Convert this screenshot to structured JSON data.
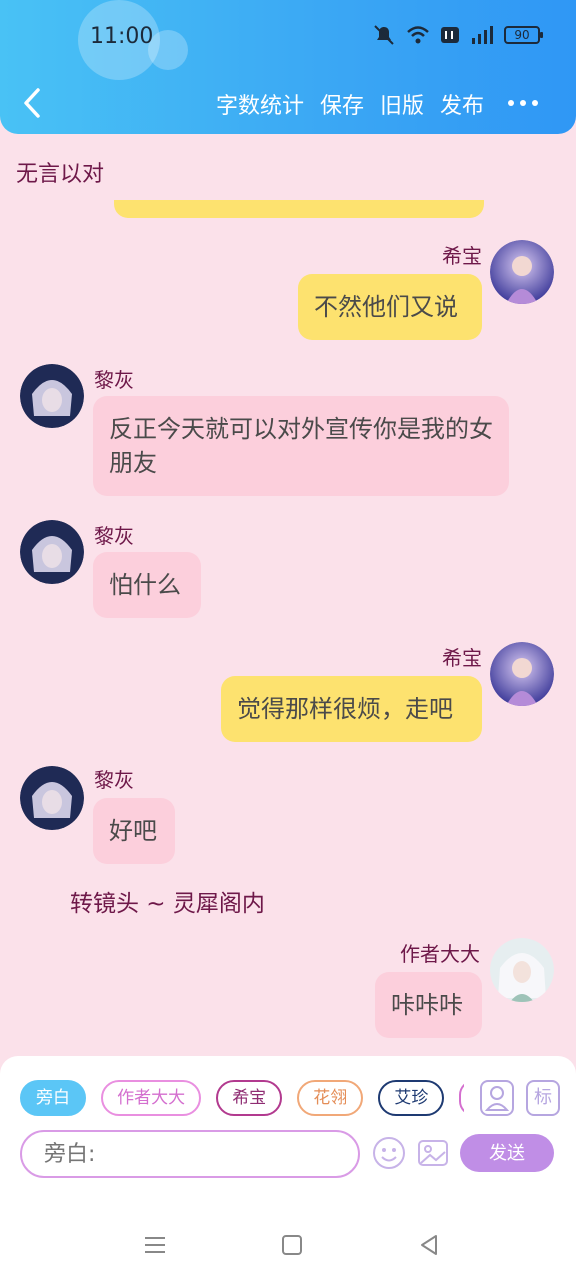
{
  "status_bar": {
    "time": "11:00",
    "battery": "90"
  },
  "header": {
    "actions": [
      {
        "label": "字数统计"
      },
      {
        "label": "保存"
      },
      {
        "label": "旧版"
      },
      {
        "label": "发布"
      }
    ]
  },
  "chat": {
    "top_narration": "无言以对",
    "messages": [
      {
        "sender": "希宝",
        "side": "right",
        "text": "不然他们又说"
      },
      {
        "sender": "黎灰",
        "side": "left",
        "text": "反正今天就可以对外宣传你是我的女朋友"
      },
      {
        "sender": "黎灰",
        "side": "left",
        "text": "怕什么"
      },
      {
        "sender": "希宝",
        "side": "right",
        "text": "觉得那样很烦，走吧"
      },
      {
        "sender": "黎灰",
        "side": "left",
        "text": "好吧"
      },
      {
        "sender": "作者大大",
        "side": "right",
        "text": "咔咔咔"
      }
    ],
    "scene_narration": "转镜头 ~ 灵犀阁内"
  },
  "composer": {
    "chips": [
      {
        "label": "旁白",
        "selected": true
      },
      {
        "label": "作者大大"
      },
      {
        "label": "希宝"
      },
      {
        "label": "花翎"
      },
      {
        "label": "艾珍"
      }
    ],
    "mark_button": "标",
    "placeholder": "旁白:",
    "send_label": "发送"
  },
  "colors": {
    "header": "#3aa6f4",
    "background": "#fbe1ea",
    "right_bubble": "#fde26f",
    "left_bubble": "#fccfdc",
    "name_text": "#6e1849",
    "send_button": "#c08ee6"
  }
}
